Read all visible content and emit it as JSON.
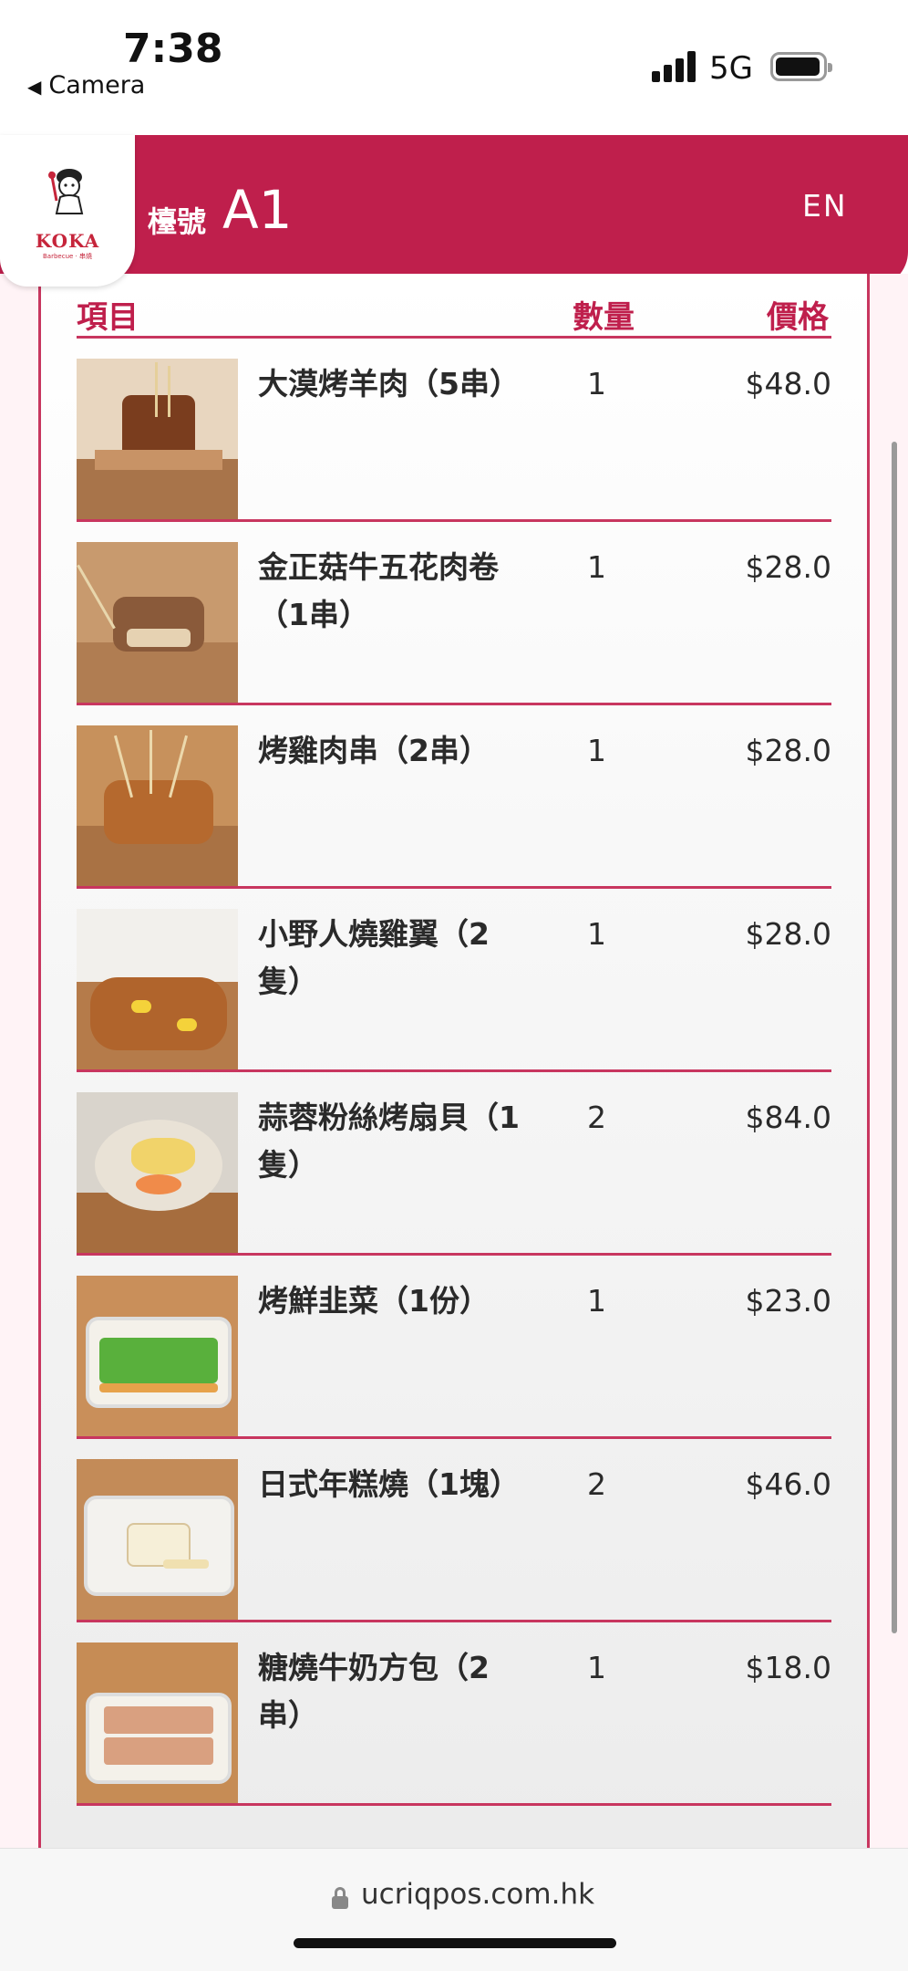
{
  "status": {
    "time": "7:38",
    "back_label": "Camera",
    "network": "5G"
  },
  "header": {
    "logo_text": "KOKA",
    "logo_sub": "Barbecue · 串燒",
    "table_label": "檯號",
    "table_number": "A1",
    "language_button": "EN",
    "accent_color": "#bf1f4c"
  },
  "order": {
    "columns": {
      "item": "項目",
      "qty": "數量",
      "price": "價格"
    },
    "items": [
      {
        "name": "大漠烤羊肉（5串）",
        "qty": "1",
        "price": "$48.0",
        "image": "lamb-skewers"
      },
      {
        "name": "金正菇牛五花肉卷（1串）",
        "qty": "1",
        "price": "$28.0",
        "image": "beef-mushroom-roll"
      },
      {
        "name": "烤雞肉串（2串）",
        "qty": "1",
        "price": "$28.0",
        "image": "chicken-skewers"
      },
      {
        "name": "小野人燒雞翼（2隻）",
        "qty": "1",
        "price": "$28.0",
        "image": "chicken-wings"
      },
      {
        "name": "蒜蓉粉絲烤扇貝（1隻）",
        "qty": "2",
        "price": "$84.0",
        "image": "garlic-scallop"
      },
      {
        "name": "烤鮮韭菜（1份）",
        "qty": "1",
        "price": "$23.0",
        "image": "chives"
      },
      {
        "name": "日式年糕燒（1塊）",
        "qty": "2",
        "price": "$46.0",
        "image": "rice-cake"
      },
      {
        "name": "糖燒牛奶方包（2串）",
        "qty": "1",
        "price": "$18.0",
        "image": "milk-toast"
      }
    ]
  },
  "browser": {
    "url": "ucriqpos.com.hk"
  }
}
